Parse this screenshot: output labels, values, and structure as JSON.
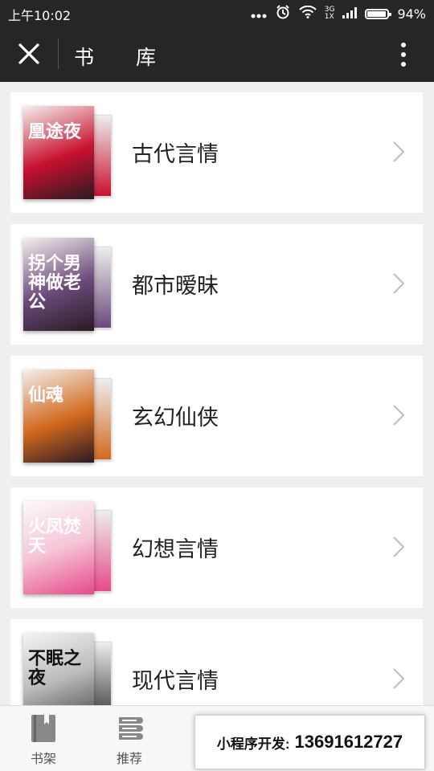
{
  "status_bar": {
    "time": "上午10:02",
    "network_top": "3G",
    "network_bottom": "1X",
    "battery_text": "94%",
    "battery_level": 0.94
  },
  "nav": {
    "title": "书 库",
    "close_icon": "close-icon",
    "more_icon": "more-vertical-icon"
  },
  "categories": [
    {
      "label": "古代言情",
      "cover_title": "凰途夜",
      "accent": "#c8102e"
    },
    {
      "label": "都市暧昧",
      "cover_title": "拐个男神做老公",
      "accent": "#6a4a7a"
    },
    {
      "label": "玄幻仙侠",
      "cover_title": "仙魂",
      "accent": "#d2691e"
    },
    {
      "label": "幻想言情",
      "cover_title": "火凤焚天",
      "accent": "#e64a8a"
    },
    {
      "label": "现代言情",
      "cover_title": "不眠之夜",
      "accent": "#333333"
    }
  ],
  "tabbar": {
    "tabs": [
      {
        "label": "书架",
        "icon": "book-icon"
      },
      {
        "label": "推荐",
        "icon": "stack-icon"
      }
    ]
  },
  "promo": {
    "label": "小程序开发:",
    "phone": "13691612727"
  }
}
